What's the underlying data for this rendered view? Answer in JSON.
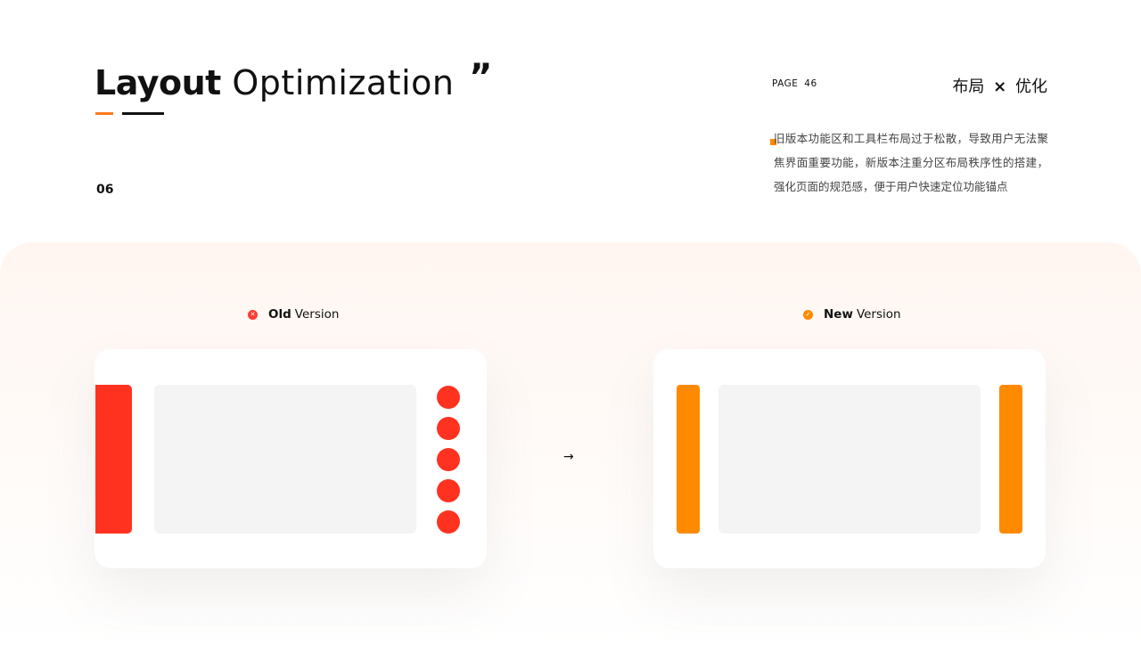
{
  "header": {
    "title_bold": "Layout",
    "title_light": "Optimization",
    "quote_mark": "”",
    "section_number": "06"
  },
  "meta": {
    "page_label": "PAGE",
    "page_number": "46",
    "topic_left": "布局",
    "topic_cross": "×",
    "topic_right": "优化",
    "description": "旧版本功能区和工具栏布局过于松散，导致用户无法聚焦界面重要功能，新版本注重分区布局秩序性的搭建，强化页面的规范感，便于用户快速定位功能锚点"
  },
  "comparison": {
    "old_label_bold": "Old",
    "old_label_rest": "Version",
    "new_label_bold": "New",
    "new_label_rest": "Version",
    "arrow": "→",
    "old_icon": "close-icon",
    "new_icon": "check-icon"
  },
  "colors": {
    "accent_orange": "#ff8a00",
    "old_red": "#ff3220",
    "content_gray": "#f4f4f4"
  }
}
